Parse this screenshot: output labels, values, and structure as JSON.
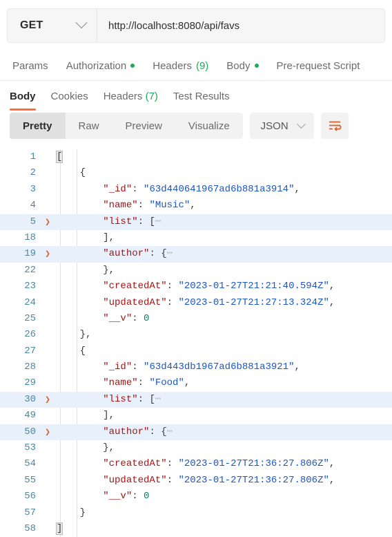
{
  "request": {
    "method": "GET",
    "method_icon": "chevron-down-icon",
    "url": "http://localhost:8080/api/favs",
    "tabs": [
      {
        "label": "Params",
        "badge": "",
        "dot": false
      },
      {
        "label": "Authorization",
        "badge": "",
        "dot": true
      },
      {
        "label": "Headers",
        "badge": "(9)",
        "dot": false
      },
      {
        "label": "Body",
        "badge": "",
        "dot": true
      },
      {
        "label": "Pre-request Script",
        "badge": "",
        "dot": false
      }
    ]
  },
  "response": {
    "tabs": [
      {
        "label": "Body",
        "badge": "",
        "active": true
      },
      {
        "label": "Cookies",
        "badge": "",
        "active": false
      },
      {
        "label": "Headers",
        "badge": "(7)",
        "active": false
      },
      {
        "label": "Test Results",
        "badge": "",
        "active": false
      }
    ],
    "formats": [
      {
        "label": "Pretty",
        "active": true
      },
      {
        "label": "Raw",
        "active": false
      },
      {
        "label": "Preview",
        "active": false
      },
      {
        "label": "Visualize",
        "active": false
      }
    ],
    "language": "JSON",
    "language_icon": "chevron-down-icon",
    "wrap_icon": "word-wrap-icon"
  },
  "colors": {
    "accent": "#ff6c37",
    "green": "#1bab5a",
    "key": "#a31515",
    "string": "#1a56c4",
    "number": "#098658",
    "gutter": "#4c87a6",
    "highlight_row": "#e8f1fb"
  },
  "code_lines": [
    {
      "num": "1",
      "fold": "",
      "highlight": false,
      "indent": 0,
      "tokens": [
        {
          "t": "[",
          "c": "punct",
          "bracket": true
        }
      ]
    },
    {
      "num": "2",
      "fold": "",
      "highlight": false,
      "indent": 1,
      "tokens": [
        {
          "t": "{",
          "c": "punct"
        }
      ]
    },
    {
      "num": "3",
      "fold": "",
      "highlight": false,
      "indent": 2,
      "tokens": [
        {
          "t": "\"_id\"",
          "c": "key"
        },
        {
          "t": ": ",
          "c": "punct"
        },
        {
          "t": "\"63d440641967ad6b881a3914\"",
          "c": "str"
        },
        {
          "t": ",",
          "c": "punct"
        }
      ]
    },
    {
      "num": "4",
      "fold": "",
      "highlight": false,
      "indent": 2,
      "tokens": [
        {
          "t": "\"name\"",
          "c": "key"
        },
        {
          "t": ": ",
          "c": "punct"
        },
        {
          "t": "\"Music\"",
          "c": "str"
        },
        {
          "t": ",",
          "c": "punct"
        }
      ]
    },
    {
      "num": "5",
      "fold": ">",
      "highlight": true,
      "indent": 2,
      "tokens": [
        {
          "t": "\"list\"",
          "c": "key"
        },
        {
          "t": ": ",
          "c": "punct"
        },
        {
          "t": "[",
          "c": "punct"
        },
        {
          "t": "⋯",
          "c": "gray"
        }
      ]
    },
    {
      "num": "18",
      "fold": "",
      "highlight": false,
      "indent": 2,
      "tokens": [
        {
          "t": "],",
          "c": "punct"
        }
      ]
    },
    {
      "num": "19",
      "fold": ">",
      "highlight": true,
      "indent": 2,
      "tokens": [
        {
          "t": "\"author\"",
          "c": "key"
        },
        {
          "t": ": ",
          "c": "punct"
        },
        {
          "t": "{",
          "c": "punct"
        },
        {
          "t": "⋯",
          "c": "gray"
        }
      ]
    },
    {
      "num": "22",
      "fold": "",
      "highlight": false,
      "indent": 2,
      "tokens": [
        {
          "t": "},",
          "c": "punct"
        }
      ]
    },
    {
      "num": "23",
      "fold": "",
      "highlight": false,
      "indent": 2,
      "tokens": [
        {
          "t": "\"createdAt\"",
          "c": "key"
        },
        {
          "t": ": ",
          "c": "punct"
        },
        {
          "t": "\"2023-01-27T21:21:40.594Z\"",
          "c": "str"
        },
        {
          "t": ",",
          "c": "punct"
        }
      ]
    },
    {
      "num": "24",
      "fold": "",
      "highlight": false,
      "indent": 2,
      "tokens": [
        {
          "t": "\"updatedAt\"",
          "c": "key"
        },
        {
          "t": ": ",
          "c": "punct"
        },
        {
          "t": "\"2023-01-27T21:27:13.324Z\"",
          "c": "str"
        },
        {
          "t": ",",
          "c": "punct"
        }
      ]
    },
    {
      "num": "25",
      "fold": "",
      "highlight": false,
      "indent": 2,
      "tokens": [
        {
          "t": "\"__v\"",
          "c": "key"
        },
        {
          "t": ": ",
          "c": "punct"
        },
        {
          "t": "0",
          "c": "num"
        }
      ]
    },
    {
      "num": "26",
      "fold": "",
      "highlight": false,
      "indent": 1,
      "tokens": [
        {
          "t": "},",
          "c": "punct"
        }
      ]
    },
    {
      "num": "27",
      "fold": "",
      "highlight": false,
      "indent": 1,
      "tokens": [
        {
          "t": "{",
          "c": "punct"
        }
      ]
    },
    {
      "num": "28",
      "fold": "",
      "highlight": false,
      "indent": 2,
      "tokens": [
        {
          "t": "\"_id\"",
          "c": "key"
        },
        {
          "t": ": ",
          "c": "punct"
        },
        {
          "t": "\"63d443db1967ad6b881a3921\"",
          "c": "str"
        },
        {
          "t": ",",
          "c": "punct"
        }
      ]
    },
    {
      "num": "29",
      "fold": "",
      "highlight": false,
      "indent": 2,
      "tokens": [
        {
          "t": "\"name\"",
          "c": "key"
        },
        {
          "t": ": ",
          "c": "punct"
        },
        {
          "t": "\"Food\"",
          "c": "str"
        },
        {
          "t": ",",
          "c": "punct"
        }
      ]
    },
    {
      "num": "30",
      "fold": ">",
      "highlight": true,
      "indent": 2,
      "tokens": [
        {
          "t": "\"list\"",
          "c": "key"
        },
        {
          "t": ": ",
          "c": "punct"
        },
        {
          "t": "[",
          "c": "punct"
        },
        {
          "t": "⋯",
          "c": "gray"
        }
      ]
    },
    {
      "num": "49",
      "fold": "",
      "highlight": false,
      "indent": 2,
      "tokens": [
        {
          "t": "],",
          "c": "punct"
        }
      ]
    },
    {
      "num": "50",
      "fold": ">",
      "highlight": true,
      "indent": 2,
      "tokens": [
        {
          "t": "\"author\"",
          "c": "key"
        },
        {
          "t": ": ",
          "c": "punct"
        },
        {
          "t": "{",
          "c": "punct"
        },
        {
          "t": "⋯",
          "c": "gray"
        }
      ]
    },
    {
      "num": "53",
      "fold": "",
      "highlight": false,
      "indent": 2,
      "tokens": [
        {
          "t": "},",
          "c": "punct"
        }
      ]
    },
    {
      "num": "54",
      "fold": "",
      "highlight": false,
      "indent": 2,
      "tokens": [
        {
          "t": "\"createdAt\"",
          "c": "key"
        },
        {
          "t": ": ",
          "c": "punct"
        },
        {
          "t": "\"2023-01-27T21:36:27.806Z\"",
          "c": "str"
        },
        {
          "t": ",",
          "c": "punct"
        }
      ]
    },
    {
      "num": "55",
      "fold": "",
      "highlight": false,
      "indent": 2,
      "tokens": [
        {
          "t": "\"updatedAt\"",
          "c": "key"
        },
        {
          "t": ": ",
          "c": "punct"
        },
        {
          "t": "\"2023-01-27T21:36:27.806Z\"",
          "c": "str"
        },
        {
          "t": ",",
          "c": "punct"
        }
      ]
    },
    {
      "num": "56",
      "fold": "",
      "highlight": false,
      "indent": 2,
      "tokens": [
        {
          "t": "\"__v\"",
          "c": "key"
        },
        {
          "t": ": ",
          "c": "punct"
        },
        {
          "t": "0",
          "c": "num"
        }
      ]
    },
    {
      "num": "57",
      "fold": "",
      "highlight": false,
      "indent": 1,
      "tokens": [
        {
          "t": "}",
          "c": "punct"
        }
      ]
    },
    {
      "num": "58",
      "fold": "",
      "highlight": false,
      "indent": 0,
      "tokens": [
        {
          "t": "]",
          "c": "punct",
          "bracket": true
        }
      ]
    }
  ]
}
